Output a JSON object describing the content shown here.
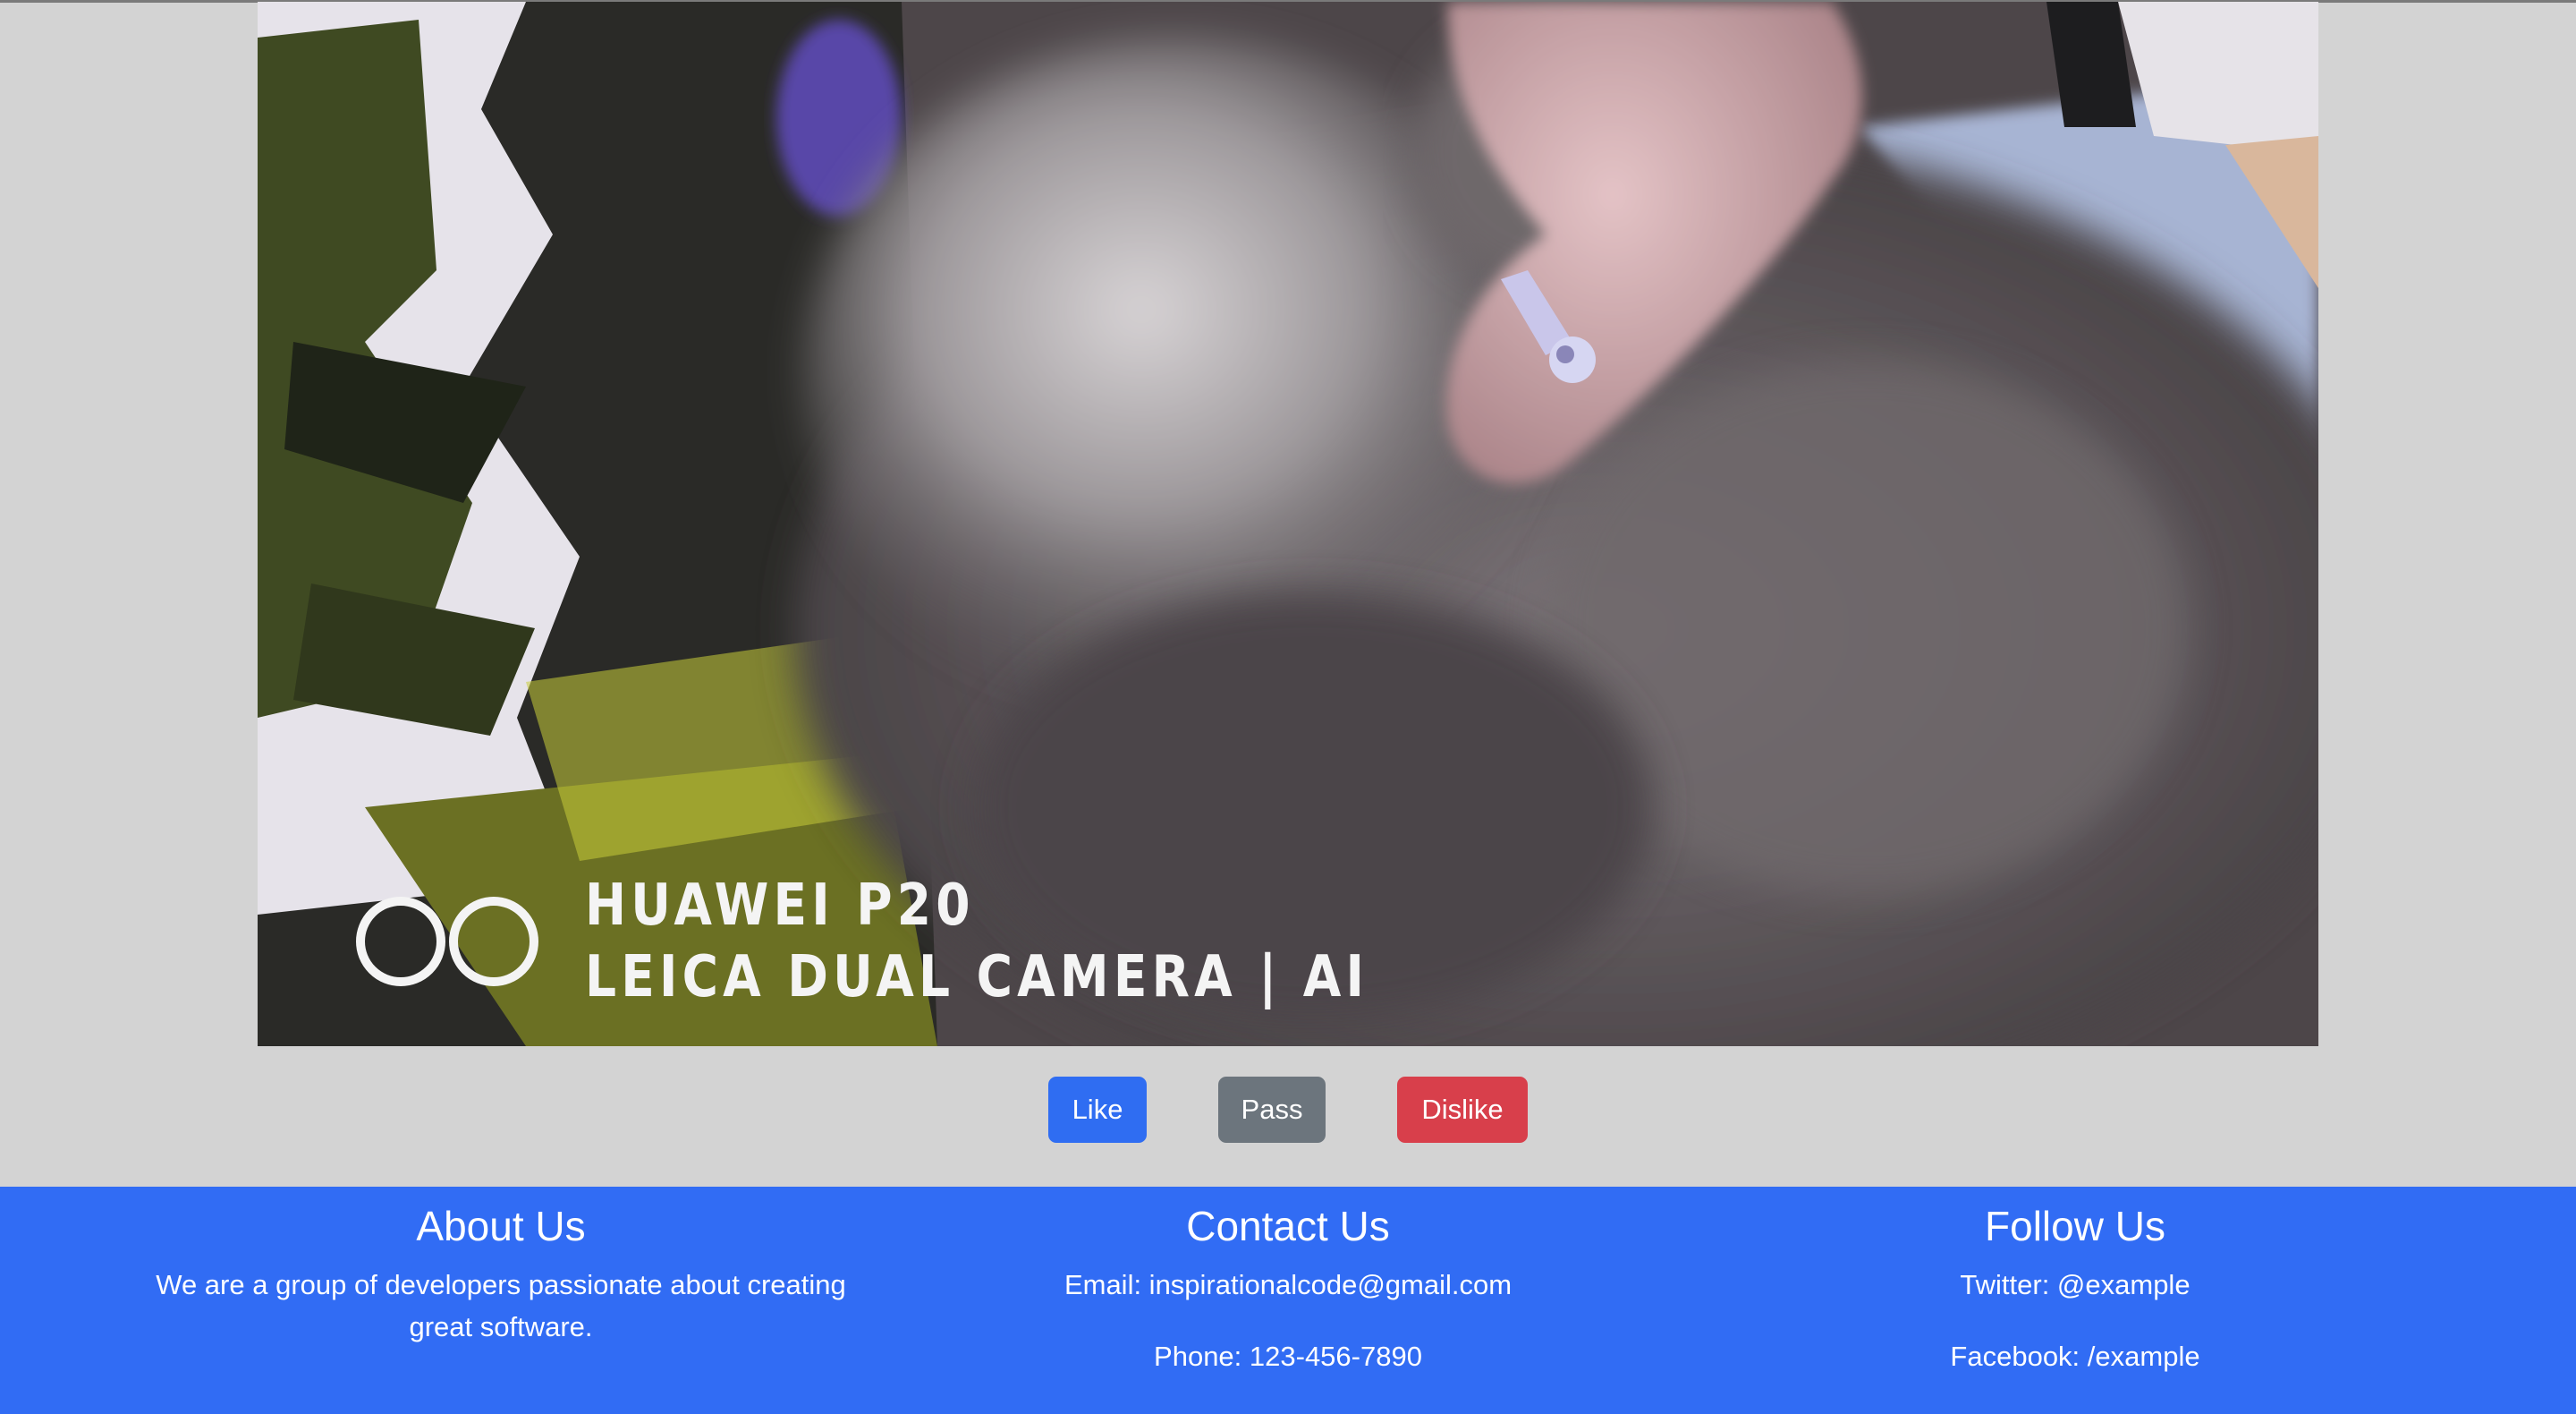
{
  "photo": {
    "overlay_line1": "HUAWEI P20",
    "overlay_line2": "LEICA DUAL CAMERA | AI"
  },
  "actions": {
    "like_label": "Like",
    "pass_label": "Pass",
    "dislike_label": "Dislike"
  },
  "footer": {
    "about": {
      "title": "About Us",
      "text": "We are a group of developers passionate about creating great software."
    },
    "contact": {
      "title": "Contact Us",
      "email": "Email: inspirationalcode@gmail.com",
      "phone": "Phone: 123-456-7890"
    },
    "follow": {
      "title": "Follow Us",
      "twitter": "Twitter: @example",
      "facebook": "Facebook: /example"
    }
  },
  "colors": {
    "page_background": "#d3d3d3",
    "footer_background": "#316cf4",
    "like": "#2f6df2",
    "pass": "#6c757d",
    "dislike": "#d83f4b"
  }
}
